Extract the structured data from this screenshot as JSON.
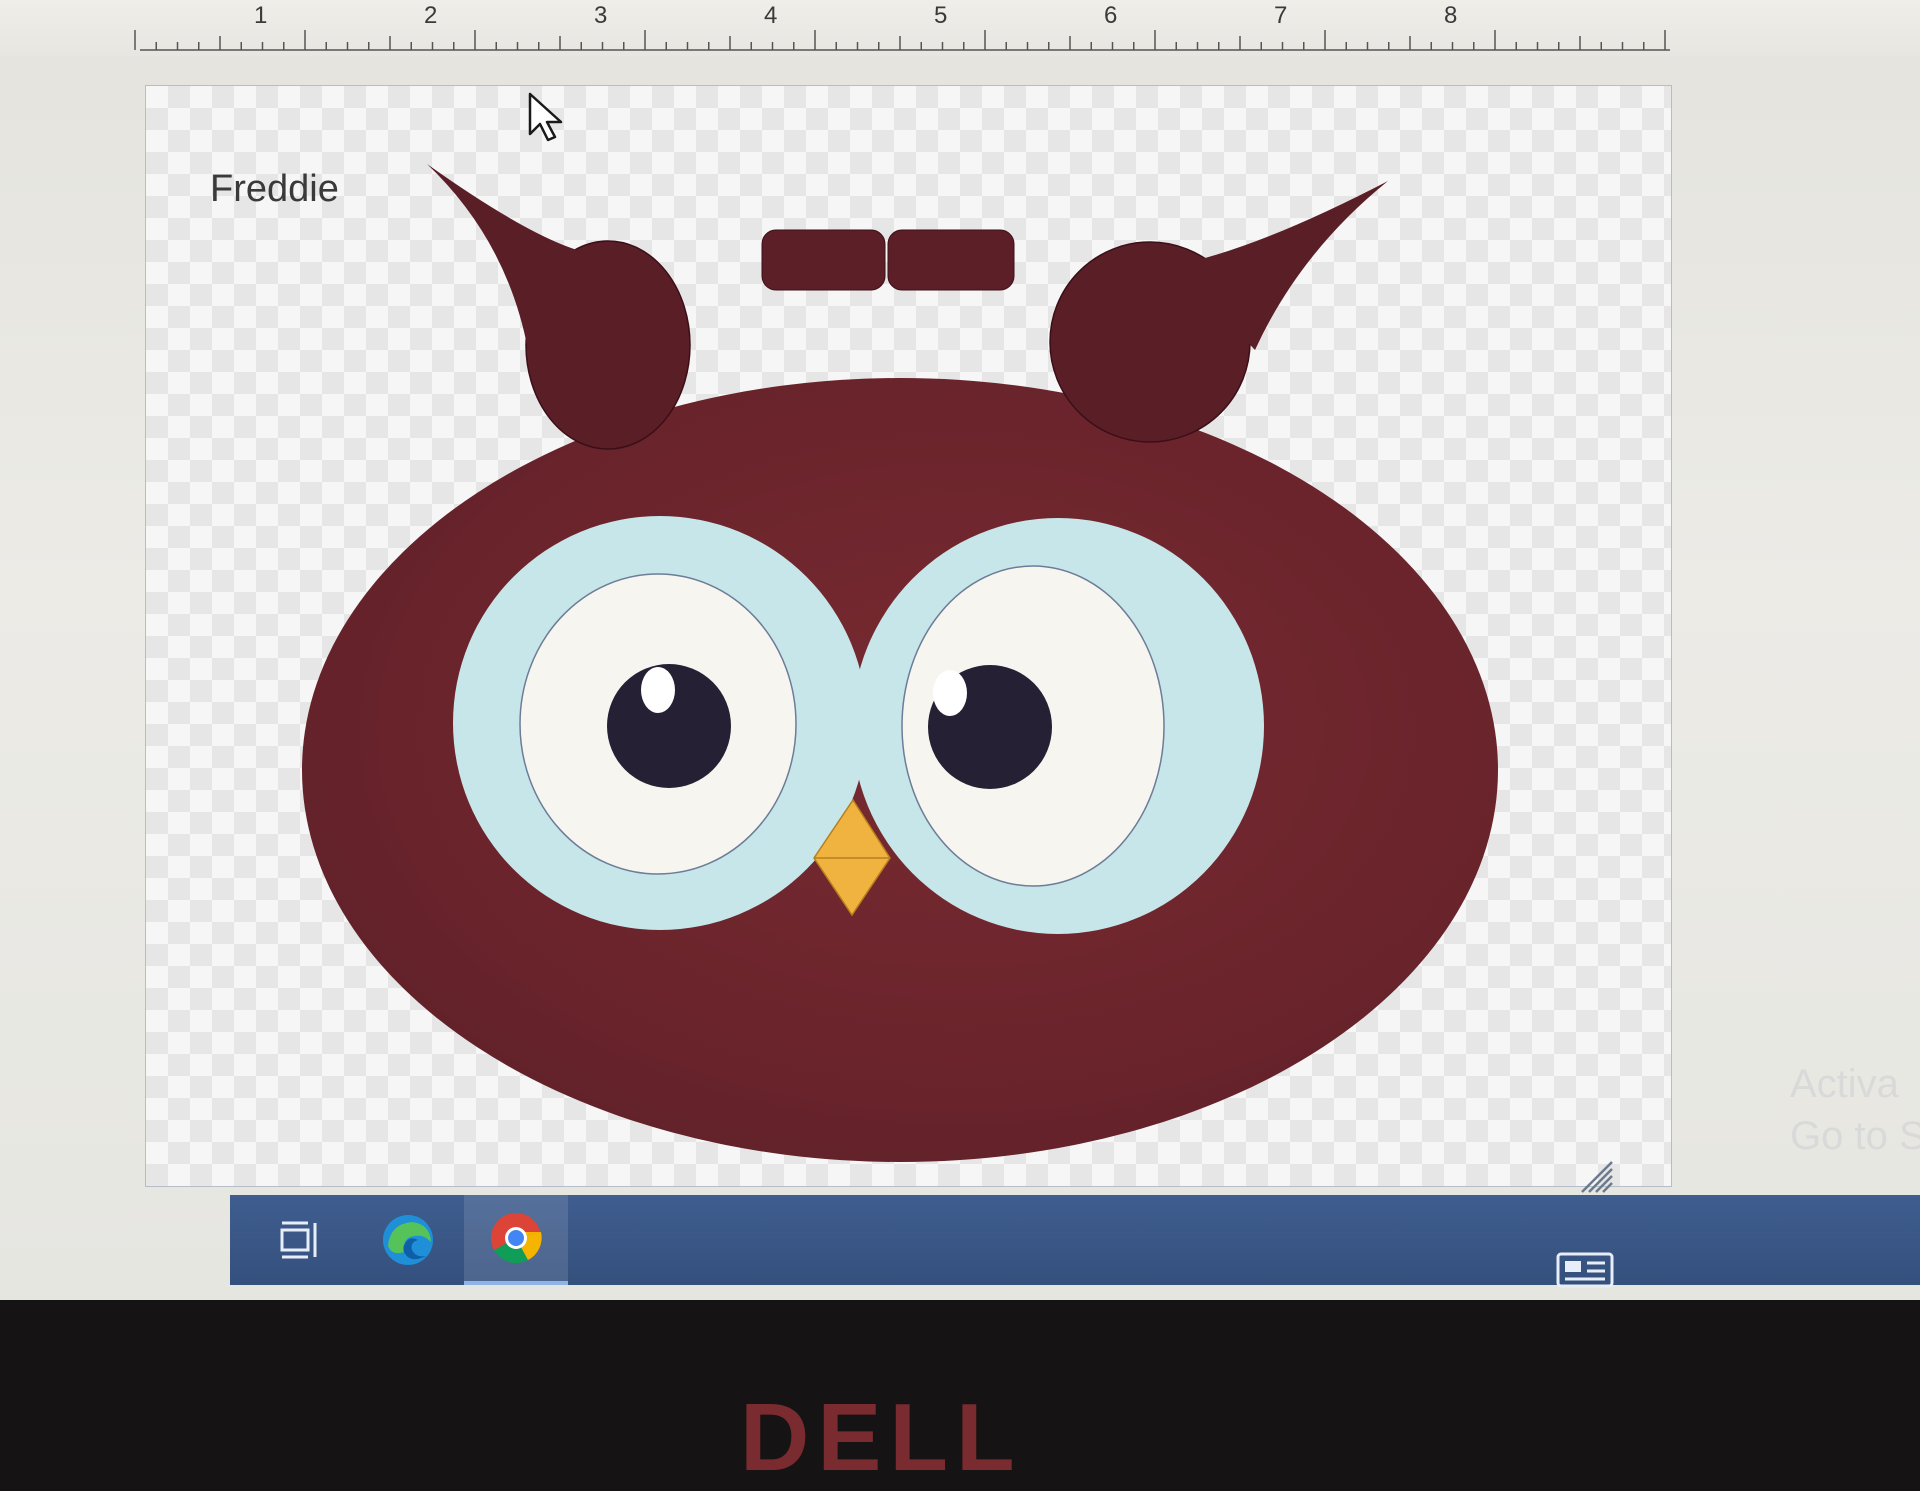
{
  "ruler": {
    "numbers": [
      "1",
      "2",
      "3",
      "4",
      "5",
      "6",
      "7",
      "8"
    ]
  },
  "drawing": {
    "title": "Freddie",
    "colors": {
      "body": "#6e2a30",
      "ear": "#5a1e27",
      "eye_ring": "#c7e6ea",
      "eye_white": "#f7f5f0",
      "pupil": "#252033",
      "beak": "#f1b33f",
      "canvas_border": "#b6bcc9"
    }
  },
  "watermark": {
    "line1": "Activa",
    "line2": "Go to Se"
  },
  "taskbar": {
    "color": "#3f5d8f",
    "items": [
      {
        "icon": "task-view-icon"
      },
      {
        "icon": "edge-icon"
      },
      {
        "icon": "chrome-icon"
      }
    ],
    "tray": {
      "icon": "news-icon"
    }
  },
  "bezel": {
    "logo": "DELL"
  }
}
